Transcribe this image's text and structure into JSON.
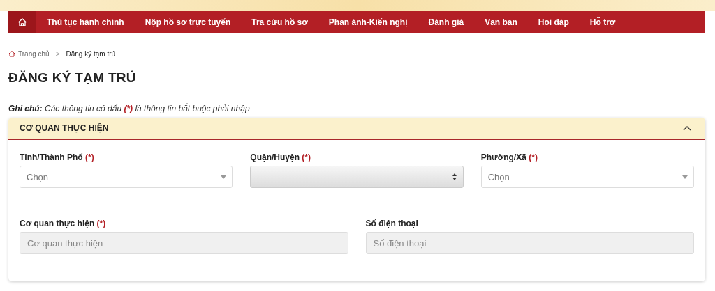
{
  "nav": {
    "home_selected": true,
    "items": [
      {
        "label": "Thủ tục hành chính",
        "selected": false
      },
      {
        "label": "Nộp hồ sơ trực tuyến",
        "selected": false
      },
      {
        "label": "Tra cứu hồ sơ",
        "selected": false
      },
      {
        "label": "Phản ánh-Kiến nghị",
        "selected": false
      },
      {
        "label": "Đánh giá",
        "selected": false
      },
      {
        "label": "Văn bản",
        "selected": false
      },
      {
        "label": "Hỏi đáp",
        "selected": false
      },
      {
        "label": "Hỗ trợ",
        "selected": false
      }
    ]
  },
  "breadcrumb": {
    "separator": ">",
    "items": [
      "Trang chủ",
      "Đăng ký tạm trú"
    ]
  },
  "title": "ĐĂNG KÝ TẠM TRÚ",
  "note": {
    "label": "Ghi chú:",
    "before": "Các thông tin có dấu",
    "mark": "(*)",
    "after": "là thông tin bắt buộc phải nhập"
  },
  "panel": {
    "title": "CƠ QUAN THỰC HIỆN",
    "expanded": true,
    "rows": [
      [
        {
          "label": "Tỉnh/Thành Phố",
          "required_mark": "(*)",
          "kind": "select",
          "placeholder": "Chọn",
          "disabled": false
        },
        {
          "label": "Quận/Huyện",
          "required_mark": "(*)",
          "kind": "select",
          "disabled": true
        },
        {
          "label": "Phường/Xã",
          "required_mark": "(*)",
          "kind": "select",
          "placeholder": "Chọn",
          "disabled": false
        }
      ],
      [
        {
          "label": "Cơ quan thực hiện",
          "required_mark": "(*)",
          "kind": "input",
          "placeholder": "Cơ quan thực hiện",
          "disabled": true
        },
        {
          "label": "Số điện thoại",
          "kind": "input",
          "placeholder": "Số điện thoại",
          "disabled": true
        }
      ]
    ]
  }
}
